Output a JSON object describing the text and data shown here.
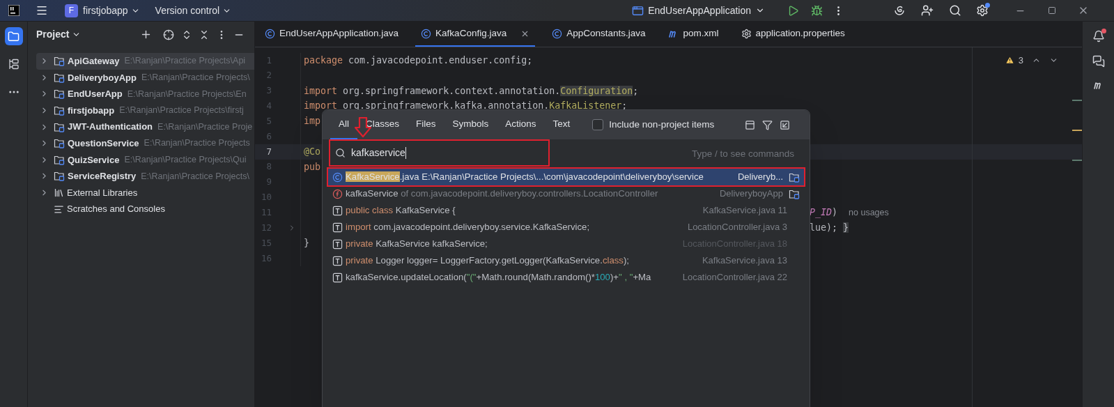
{
  "title_bar": {
    "project_badge": "F",
    "project": "firstjobapp",
    "vcs": "Version control",
    "run_config": "EndUserAppApplication"
  },
  "tool_stripe": [
    {
      "kind": "project",
      "selected": true
    },
    {
      "kind": "structure",
      "selected": false
    },
    {
      "kind": "more",
      "selected": false
    }
  ],
  "project_panel": {
    "title": "Project",
    "items": [
      {
        "kind": "module",
        "name": "ApiGateway",
        "path": "E:\\Ranjan\\Practice Projects\\Api",
        "selected": true
      },
      {
        "kind": "module",
        "name": "DeliveryboyApp",
        "path": "E:\\Ranjan\\Practice Projects\\",
        "selected": false
      },
      {
        "kind": "module",
        "name": "EndUserApp",
        "path": "E:\\Ranjan\\Practice Projects\\En",
        "selected": false
      },
      {
        "kind": "module",
        "name": "firstjobapp",
        "path": "E:\\Ranjan\\Practice Projects\\firstj",
        "selected": false
      },
      {
        "kind": "module",
        "name": "JWT-Authentication",
        "path": "E:\\Ranjan\\Practice Proje",
        "selected": false
      },
      {
        "kind": "module",
        "name": "QuestionService",
        "path": "E:\\Ranjan\\Practice Projects",
        "selected": false
      },
      {
        "kind": "module",
        "name": "QuizService",
        "path": "E:\\Ranjan\\Practice Projects\\Qui",
        "selected": false
      },
      {
        "kind": "module",
        "name": "ServiceRegistry",
        "path": "E:\\Ranjan\\Practice Projects\\",
        "selected": false
      },
      {
        "kind": "library",
        "name": "External Libraries",
        "selected": false
      },
      {
        "kind": "scratches",
        "name": "Scratches and Consoles",
        "selected": false
      }
    ]
  },
  "editor_tabs": [
    {
      "kind": "class",
      "label": "EndUserAppApplication.java",
      "selected": false
    },
    {
      "kind": "class",
      "label": "KafkaConfig.java",
      "selected": true
    },
    {
      "kind": "class",
      "label": "AppConstants.java",
      "selected": false
    },
    {
      "kind": "maven",
      "label": "pom.xml",
      "selected": false
    },
    {
      "kind": "settings",
      "label": "application.properties",
      "selected": false
    }
  ],
  "editor": {
    "problems": "3",
    "lines": [
      {
        "number": "1",
        "current": false,
        "fold": false,
        "segments": [
          {
            "kind": "keyword",
            "text": "package"
          },
          {
            "kind": "plain",
            "text": " com.javacodepoint.enduser.config;"
          }
        ]
      },
      {
        "number": "2",
        "current": false,
        "fold": false
      },
      {
        "number": "3",
        "current": false,
        "fold": false,
        "segments": [
          {
            "kind": "keyword",
            "text": "import"
          },
          {
            "kind": "plain",
            "text": " org.springframework.context.annotation."
          },
          {
            "kind": "annotation",
            "text": "Configuration"
          },
          {
            "kind": "plain",
            "text": ";"
          }
        ]
      },
      {
        "number": "4",
        "current": false,
        "fold": false,
        "segments": [
          {
            "kind": "keyword",
            "text": "import"
          },
          {
            "kind": "plain",
            "text": " org.springframework.kafka.annotation."
          },
          {
            "kind": "type",
            "text": "KafkaListener"
          },
          {
            "kind": "plain",
            "text": ";"
          }
        ]
      },
      {
        "number": "5",
        "current": false,
        "fold": false,
        "segments": [
          {
            "kind": "keyword",
            "text": "imp"
          }
        ]
      },
      {
        "number": "6",
        "current": false,
        "fold": false
      },
      {
        "number": "7",
        "current": true,
        "fold": false,
        "segments": [
          {
            "kind": "type",
            "text": "@Co"
          }
        ]
      },
      {
        "number": "8",
        "current": false,
        "fold": false,
        "segments": [
          {
            "kind": "keyword",
            "text": "pub"
          }
        ]
      },
      {
        "number": "9",
        "current": false,
        "fold": false
      },
      {
        "number": "10",
        "current": false,
        "fold": false
      },
      {
        "number": "11",
        "current": false,
        "fold": false,
        "tail": [
          {
            "kind": "constant",
            "text": "P_ID"
          },
          {
            "kind": "plain",
            "text": ")"
          }
        ],
        "hint": "no usages"
      },
      {
        "number": "12",
        "current": false,
        "fold": true,
        "tail": [
          {
            "kind": "plain",
            "text": "lue); "
          },
          {
            "kind": "folded",
            "text": "}"
          }
        ]
      },
      {
        "number": "15",
        "current": false,
        "fold": false,
        "segments": [
          {
            "kind": "plain",
            "text": "}"
          }
        ]
      },
      {
        "number": "16",
        "current": false,
        "fold": false
      }
    ]
  },
  "search_popup": {
    "tabs": [
      {
        "label": "All",
        "selected": true
      },
      {
        "label": "Classes",
        "selected": false
      },
      {
        "label": "Files",
        "selected": false
      },
      {
        "label": "Symbols",
        "selected": false
      },
      {
        "label": "Actions",
        "selected": false
      },
      {
        "label": "Text",
        "selected": false
      }
    ],
    "include_non_project": {
      "label": "Include non-project items",
      "checked": false
    },
    "query": "kafkaservice",
    "query_annotated": true,
    "hint": "Type / to see commands",
    "results": [
      {
        "kind": "class",
        "selected": true,
        "annotated": true,
        "folder_icon": true,
        "dimmed": false,
        "segments": [
          {
            "kind": "match",
            "text": "KafkaService"
          },
          {
            "kind": "plain",
            "text": ".java E:\\Ranjan\\Practice Projects\\...\\com\\javacodepoint\\deliveryboy\\service"
          }
        ],
        "location": "Deliveryb..."
      },
      {
        "kind": "field",
        "selected": false,
        "annotated": false,
        "folder_icon": true,
        "dimmed": false,
        "segments": [
          {
            "kind": "plain",
            "text": "kafkaService"
          },
          {
            "kind": "dim",
            "text": " of com.javacodepoint.deliveryboy.controllers.LocationController"
          }
        ],
        "location": "DeliveryboyApp"
      },
      {
        "kind": "text",
        "selected": false,
        "annotated": false,
        "folder_icon": false,
        "dimmed": false,
        "segments": [
          {
            "kind": "keyword",
            "text": "public class"
          },
          {
            "kind": "plain",
            "text": " KafkaService {"
          }
        ],
        "location": "KafkaService.java 11"
      },
      {
        "kind": "text",
        "selected": false,
        "annotated": false,
        "folder_icon": false,
        "dimmed": false,
        "segments": [
          {
            "kind": "keyword",
            "text": "import"
          },
          {
            "kind": "plain",
            "text": " com.javacodepoint.deliveryboy.service.KafkaService;"
          }
        ],
        "location": "LocationController.java 3"
      },
      {
        "kind": "text",
        "selected": false,
        "annotated": false,
        "folder_icon": false,
        "dimmed": true,
        "segments": [
          {
            "kind": "keyword",
            "text": "private"
          },
          {
            "kind": "plain",
            "text": " KafkaService kafkaService;"
          }
        ],
        "location": "LocationController.java 18"
      },
      {
        "kind": "text",
        "selected": false,
        "annotated": false,
        "folder_icon": false,
        "dimmed": false,
        "segments": [
          {
            "kind": "keyword",
            "text": "private"
          },
          {
            "kind": "plain",
            "text": " Logger logger= LoggerFactory.getLogger(KafkaService."
          },
          {
            "kind": "keyword",
            "text": "class"
          },
          {
            "kind": "plain",
            "text": ");"
          }
        ],
        "location": "KafkaService.java 13"
      },
      {
        "kind": "text",
        "selected": false,
        "annotated": false,
        "folder_icon": false,
        "dimmed": false,
        "segments": [
          {
            "kind": "plain",
            "text": "kafkaService.updateLocation("
          },
          {
            "kind": "string",
            "text": "\"(\""
          },
          {
            "kind": "plain",
            "text": "+Math.round(Math.random()*"
          },
          {
            "kind": "number",
            "text": "100"
          },
          {
            "kind": "plain",
            "text": ")+"
          },
          {
            "kind": "string",
            "text": "\" , \""
          },
          {
            "kind": "plain",
            "text": "+Ma"
          }
        ],
        "location": "LocationController.java 22"
      }
    ]
  }
}
